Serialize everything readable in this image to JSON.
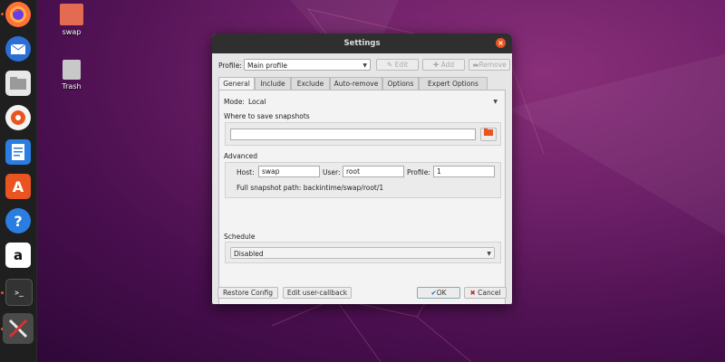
{
  "desktop": {
    "icons": [
      {
        "label": "swap",
        "icon": "folder-icon"
      },
      {
        "label": "Trash",
        "icon": "trash-icon"
      }
    ]
  },
  "dock": {
    "items": [
      {
        "name": "firefox",
        "icon": "firefox-icon"
      },
      {
        "name": "thunderbird",
        "icon": "mail-icon"
      },
      {
        "name": "files",
        "icon": "files-icon"
      },
      {
        "name": "rhythmbox",
        "icon": "music-icon"
      },
      {
        "name": "writer",
        "icon": "document-icon"
      },
      {
        "name": "software",
        "icon": "software-icon"
      },
      {
        "name": "help",
        "icon": "help-icon",
        "glyph": "?"
      },
      {
        "name": "amazon",
        "icon": "amazon-icon",
        "glyph": "a"
      },
      {
        "name": "terminal",
        "icon": "terminal-icon",
        "glyph": ">_"
      },
      {
        "name": "backintime",
        "icon": "tools-icon"
      }
    ]
  },
  "window": {
    "title": "Settings",
    "profile_label": "Profile:",
    "profile_value": "Main profile",
    "edit_label": "Edit",
    "add_label": "Add",
    "remove_label": "Remove",
    "tabs": [
      "General",
      "Include",
      "Exclude",
      "Auto-remove",
      "Options",
      "Expert Options"
    ],
    "mode_label": "Mode:",
    "mode_value": "Local",
    "where_label": "Where to save snapshots",
    "path_value": "",
    "advanced_label": "Advanced",
    "host_label": "Host:",
    "host_value": "swap",
    "user_label": "User:",
    "user_value": "root",
    "profile_num_label": "Profile:",
    "profile_num_value": "1",
    "full_path_text": "Full snapshot path: backintime/swap/root/1",
    "schedule_label": "Schedule",
    "schedule_value": "Disabled",
    "restore_config_label": "Restore Config",
    "edit_callback_label": "Edit user-callback",
    "ok_label": "OK",
    "cancel_label": "Cancel"
  },
  "colors": {
    "accent": "#e95420",
    "titlebar": "#2f2f2f"
  }
}
